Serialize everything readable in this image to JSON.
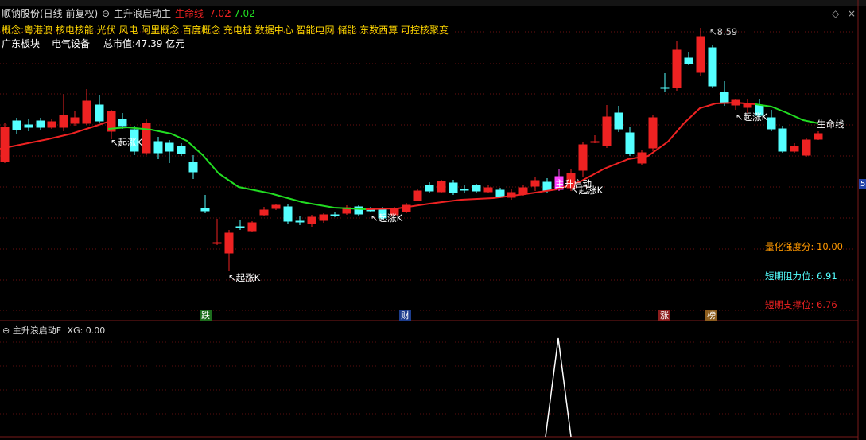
{
  "window": {
    "stock_name": "顺钠股份(日线 前复权)",
    "indicator_name": "主升浪启动主",
    "lifeline_label": "生命线",
    "lifeline_value": "7.02",
    "lifeline_value2": "7.02"
  },
  "concepts": "概念:粤港澳 核电核能 光伏 风电 阿里概念 百度概念 充电桩 数据中心 智能电网 储能 东数西算 可控核聚变",
  "info": {
    "region": "广东板块",
    "industry": "电气设备",
    "market_cap": "总市值:47.39 亿元"
  },
  "chart_labels": {
    "peak_price": "8.59",
    "lifeline_right": "生命线",
    "main_rise_start": "主升启动",
    "start_k": "起涨K"
  },
  "metrics": {
    "strength_label": "量化强度分:",
    "strength_value": "10.00",
    "resistance_label": "短期阻力位:",
    "resistance_value": "6.91",
    "support_label": "短期支撑位:",
    "support_value": "6.76"
  },
  "event_marks": [
    "跌",
    "财",
    "涨",
    "榜"
  ],
  "right_edge_marker": "5",
  "sub_panel": {
    "title": "主升浪启动F",
    "value": "XG: 0.00"
  },
  "colors": {
    "up": "#ee2222",
    "down": "#54ffff",
    "lifeline_green": "#22dd22",
    "lifeline_red": "#ee2222",
    "signal_magenta": "#ff44ff",
    "strength": "#ff9900",
    "resistance": "#54ffff",
    "support": "#ee2222"
  }
}
